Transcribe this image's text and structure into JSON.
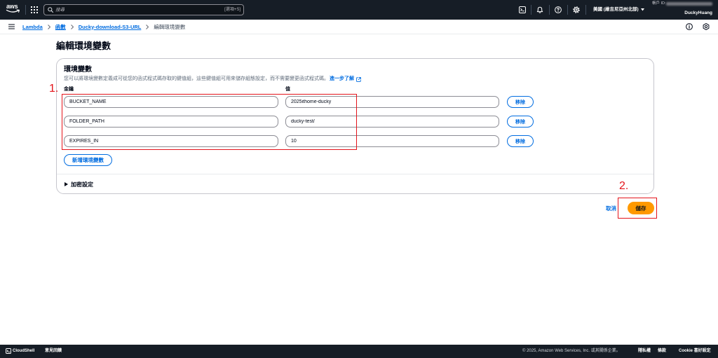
{
  "theme": {
    "nav_bg": "#161d26",
    "link": "#006ce0",
    "primary": "#ff9900",
    "annotation": "#e4141b"
  },
  "topnav": {
    "logo_text": "aws",
    "search_placeholder": "搜尋",
    "search_shortcut": "[選項+S]",
    "region": "美國 (維吉尼亞州北部)",
    "account_label": "帳戶 ID:",
    "username": "DuckyHuang",
    "icons": [
      "grid-icon",
      "search-icon",
      "terminal-icon",
      "bell-icon",
      "help-icon",
      "gear-icon",
      "caret-down-icon"
    ]
  },
  "breadcrumb": {
    "items": [
      "Lambda",
      "函數",
      "Ducky-download-S3-URL",
      "編輯環境變數"
    ],
    "icons": [
      "menu-icon",
      "chevron-right-icon",
      "info-icon",
      "settings-hex-icon"
    ]
  },
  "page": {
    "title": "編輯環境變數"
  },
  "env_vars": {
    "heading": "環境變數",
    "description": "您可以將環境變數定義成可從您的函式程式碼存取的鍵值組，這些鍵值組可用來儲存組態設定，而不需要變更函式程式碼。",
    "learn_more": "進一步了解",
    "key_header": "金鑰",
    "value_header": "值",
    "rows": [
      {
        "key": "BUCKET_NAME",
        "value": "2025ithome-ducky",
        "remove_label": "移除"
      },
      {
        "key": "FOLDER_PATH",
        "value": "ducky-test/",
        "remove_label": "移除"
      },
      {
        "key": "EXPIRES_IN",
        "value": "10",
        "remove_label": "移除"
      }
    ],
    "add_label": "新增環境變數",
    "encryption_label": "加密設定"
  },
  "actions": {
    "cancel_label": "取消",
    "save_label": "儲存"
  },
  "annotations": {
    "step1": "1.",
    "step2": "2."
  },
  "footer": {
    "cloudshell": "CloudShell",
    "feedback": "意見回饋",
    "copyright": "© 2025, Amazon Web Services, Inc. 或其關係企業。",
    "privacy": "隱私權",
    "terms": "條款",
    "cookies": "Cookie 喜好設定"
  }
}
